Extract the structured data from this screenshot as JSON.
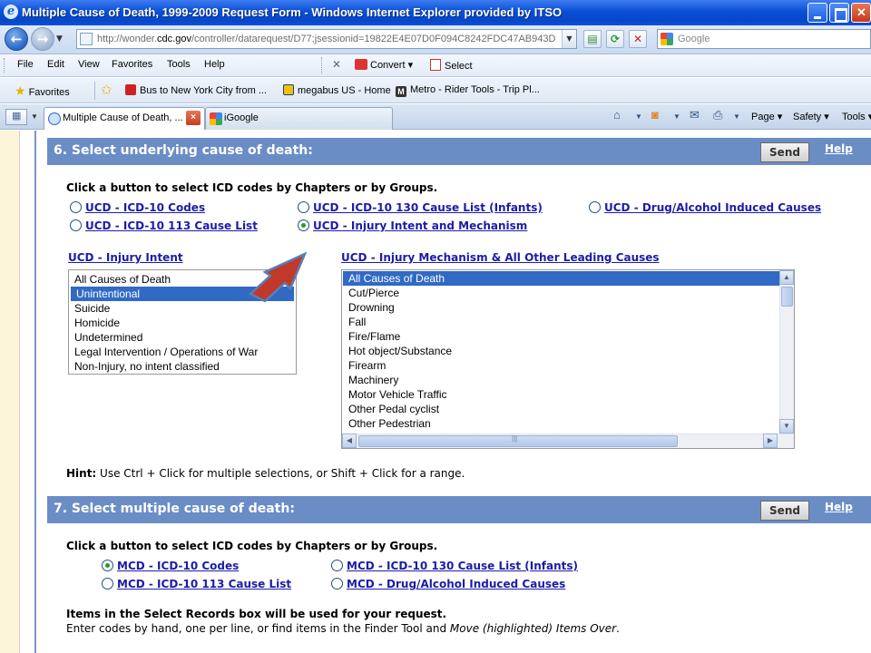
{
  "window": {
    "title": "Multiple Cause of Death, 1999-2009 Request Form - Windows Internet Explorer provided by ITSO"
  },
  "address_bar": {
    "url_prefix": "http://wonder.",
    "url_domain": "cdc.gov",
    "url_rest": "/controller/datarequest/D77;jsessionid=19822E4E07D0F094C8242FDC47AB943D",
    "search_placeholder": "Google"
  },
  "menu": {
    "items": [
      "File",
      "Edit",
      "View",
      "Favorites",
      "Tools",
      "Help"
    ],
    "convert_label": "Convert",
    "select_label": "Select"
  },
  "favorites_bar": {
    "favorites_label": "Favorites",
    "links": [
      "Bus to New York City from ...",
      "megabus US - Home",
      "Metro - Rider Tools - Trip Pl..."
    ]
  },
  "tabs": {
    "active_title": "Multiple Cause of Death, ...",
    "inactive_title": "iGoogle"
  },
  "command_bar": {
    "page_label": "Page",
    "safety_label": "Safety",
    "tools_label": "Tools"
  },
  "section6": {
    "title": "6. Select underlying cause of death:",
    "send_label": "Send",
    "help_label": "Help",
    "instruction": "Click a button to select ICD codes by Chapters or by Groups.",
    "options": [
      {
        "label": "UCD - ICD-10 Codes",
        "checked": false
      },
      {
        "label": "UCD - ICD-10 130 Cause List (Infants)",
        "checked": false
      },
      {
        "label": "UCD - Drug/Alcohol Induced Causes",
        "checked": false
      },
      {
        "label": "UCD - ICD-10 113 Cause List",
        "checked": false
      },
      {
        "label": "UCD - Injury Intent and Mechanism",
        "checked": true
      }
    ],
    "intent_title": "UCD - Injury Intent",
    "intent_items": [
      "All Causes of Death",
      "Unintentional",
      "Suicide",
      "Homicide",
      "Undetermined",
      "Legal Intervention / Operations of War",
      "Non-Injury, no intent classified"
    ],
    "intent_selected": "Unintentional",
    "mechanism_title": "UCD - Injury Mechanism & All Other Leading Causes",
    "mechanism_items": [
      "All Causes of Death",
      "Cut/Pierce",
      "Drowning",
      "Fall",
      "Fire/Flame",
      "Hot object/Substance",
      "Firearm",
      "Machinery",
      "Motor Vehicle Traffic",
      "Other Pedal cyclist",
      "Other Pedestrian"
    ],
    "mechanism_selected": "All Causes of Death",
    "hint_label": "Hint:",
    "hint_text": " Use Ctrl + Click for multiple selections, or Shift + Click for a range."
  },
  "section7": {
    "title": "7. Select multiple cause of death:",
    "send_label": "Send",
    "help_label": "Help",
    "instruction": "Click a button to select ICD codes by Chapters or by Groups.",
    "options": [
      {
        "label": "MCD - ICD-10 Codes",
        "checked": true
      },
      {
        "label": "MCD - ICD-10 130 Cause List (Infants)",
        "checked": false
      },
      {
        "label": "MCD - ICD-10 113 Cause List",
        "checked": false
      },
      {
        "label": "MCD - Drug/Alcohol Induced Causes",
        "checked": false
      }
    ],
    "records_note": "Items in the Select Records box will be used for your request.",
    "enter_codes_text": "Enter codes by hand, one per line, or find items in the Finder Tool and ",
    "enter_codes_italic": "Move (highlighted) Items Over",
    "enter_codes_end": "."
  },
  "colors": {
    "section_bar": "#6b8dc6",
    "link_blue": "#1c1ca8",
    "selection": "#316ac5",
    "arrow": "#c0392b"
  }
}
